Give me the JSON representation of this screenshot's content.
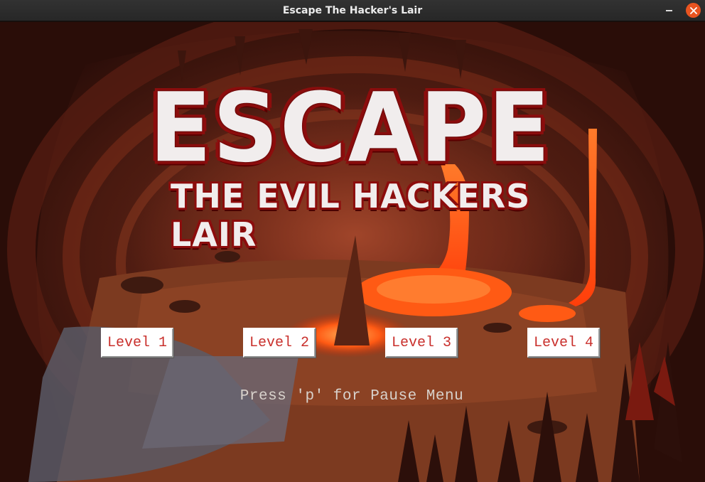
{
  "window": {
    "title": "Escape The Hacker's Lair",
    "controls": {
      "minimize_icon": "minimize-icon",
      "close_icon": "close-icon"
    }
  },
  "logo": {
    "main_text": "ESCAPE",
    "sub_text": "THE EVIL HACKERS LAIR",
    "fill_color": "#f1eded",
    "outline_color": "#8c0d0d"
  },
  "levels": [
    {
      "label": "Level 1"
    },
    {
      "label": "Level 2"
    },
    {
      "label": "Level 3"
    },
    {
      "label": "Level 4"
    }
  ],
  "hint": {
    "text": "Press 'p' for Pause Menu"
  },
  "colors": {
    "button_text": "#c9302c",
    "button_bg": "#ffffff",
    "lava": "#ff5a14",
    "titlebar": "#2c2c2c",
    "close_button": "#e95420"
  }
}
